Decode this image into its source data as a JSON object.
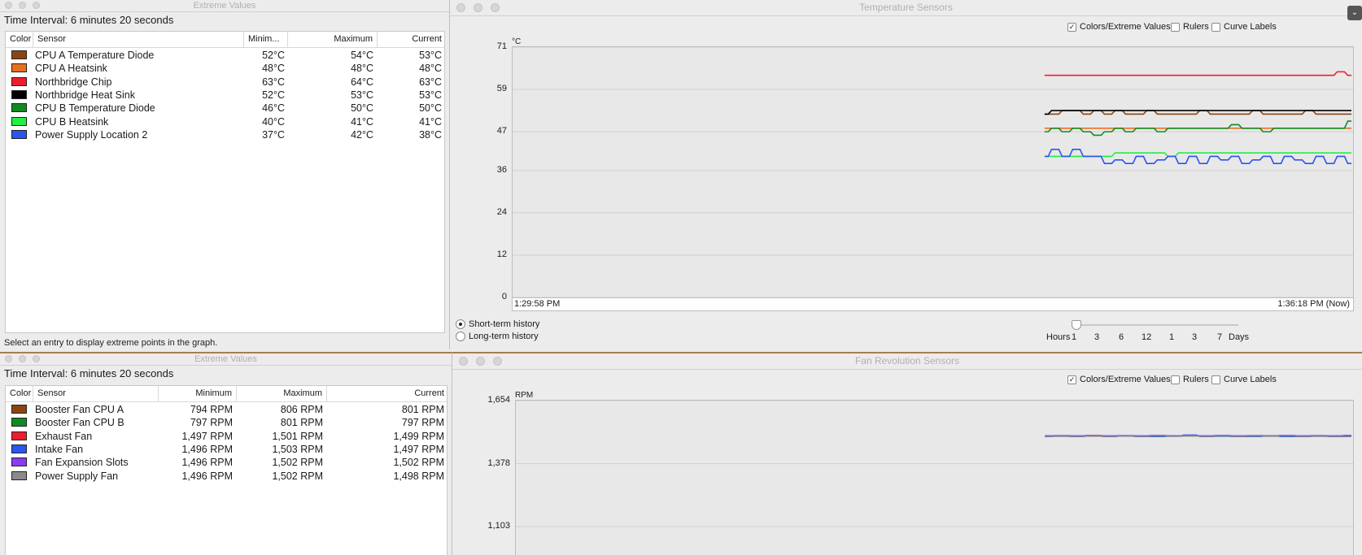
{
  "extreme_top": {
    "window_title": "Extreme Values",
    "interval": "Time Interval: 6 minutes 20 seconds",
    "headers": {
      "color": "Color",
      "sensor": "Sensor",
      "min": "Minim...",
      "max": "Maximum",
      "current": "Current"
    },
    "rows": [
      {
        "color": "#8b4513",
        "sensor": "CPU A Temperature Diode",
        "min": "52°C",
        "max": "54°C",
        "current": "53°C"
      },
      {
        "color": "#e87020",
        "sensor": "CPU A Heatsink",
        "min": "48°C",
        "max": "48°C",
        "current": "48°C"
      },
      {
        "color": "#ee1c2e",
        "sensor": "Northbridge Chip",
        "min": "63°C",
        "max": "64°C",
        "current": "63°C"
      },
      {
        "color": "#000000",
        "sensor": "Northbridge Heat Sink",
        "min": "52°C",
        "max": "53°C",
        "current": "53°C"
      },
      {
        "color": "#128a22",
        "sensor": "CPU B Temperature Diode",
        "min": "46°C",
        "max": "50°C",
        "current": "50°C"
      },
      {
        "color": "#22ee44",
        "sensor": "CPU B Heatsink",
        "min": "40°C",
        "max": "41°C",
        "current": "41°C"
      },
      {
        "color": "#2a55f0",
        "sensor": "Power Supply Location 2",
        "min": "37°C",
        "max": "42°C",
        "current": "38°C"
      }
    ],
    "status": "Select an entry to display extreme points in the graph."
  },
  "extreme_bottom": {
    "window_title": "Extreme Values",
    "interval": "Time Interval: 6 minutes 20 seconds",
    "headers": {
      "color": "Color",
      "sensor": "Sensor",
      "min": "Minimum",
      "max": "Maximum",
      "current": "Current"
    },
    "rows": [
      {
        "color": "#8b4513",
        "sensor": "Booster Fan CPU A",
        "min": "794 RPM",
        "max": "806 RPM",
        "current": "801 RPM"
      },
      {
        "color": "#128a22",
        "sensor": "Booster Fan CPU B",
        "min": "797 RPM",
        "max": "801 RPM",
        "current": "797 RPM"
      },
      {
        "color": "#ee1c2e",
        "sensor": "Exhaust Fan",
        "min": "1,497 RPM",
        "max": "1,501 RPM",
        "current": "1,499 RPM"
      },
      {
        "color": "#2a55f0",
        "sensor": "Intake Fan",
        "min": "1,496 RPM",
        "max": "1,503 RPM",
        "current": "1,497 RPM"
      },
      {
        "color": "#8a3cf0",
        "sensor": "Fan Expansion Slots",
        "min": "1,496 RPM",
        "max": "1,502 RPM",
        "current": "1,502 RPM"
      },
      {
        "color": "#8a8a8a",
        "sensor": "Power Supply Fan",
        "min": "1,496 RPM",
        "max": "1,502 RPM",
        "current": "1,498 RPM"
      }
    ]
  },
  "temp_window": {
    "window_title": "Temperature Sensors",
    "options": {
      "colors": "Colors/Extreme Values",
      "rulers": "Rulers",
      "curve_labels": "Curve Labels"
    },
    "radio_short": "Short-term history",
    "radio_long": "Long-term history",
    "slider": {
      "hours": "Hours",
      "days": "Days",
      "ticks": [
        "1",
        "3",
        "6",
        "12",
        "1",
        "3",
        "7"
      ]
    }
  },
  "fan_window": {
    "window_title": "Fan Revolution Sensors",
    "options": {
      "colors": "Colors/Extreme Values",
      "rulers": "Rulers",
      "curve_labels": "Curve Labels"
    }
  },
  "chart_data": [
    {
      "type": "line",
      "ylabel": "°C",
      "ylim": [
        0,
        71
      ],
      "yticks": [
        "71",
        "59",
        "47",
        "36",
        "24",
        "12",
        "0"
      ],
      "x_start_label": "1:29:58 PM",
      "x_end_label": "1:36:18 PM (Now)",
      "grid": true,
      "series": [
        {
          "name": "CPU A Temperature Diode",
          "color": "#8b4513",
          "values": [
            52,
            52,
            53,
            53,
            52,
            53,
            52,
            53,
            52,
            52,
            53,
            52,
            52,
            52,
            52,
            53,
            52,
            52,
            52,
            52,
            53,
            52,
            52,
            52,
            52,
            53,
            52,
            52,
            52,
            52
          ]
        },
        {
          "name": "CPU A Heatsink",
          "color": "#e87020",
          "values": [
            48,
            48,
            48,
            48,
            48,
            48,
            48,
            48,
            48,
            48,
            48,
            48,
            48,
            48,
            48,
            48,
            48,
            48,
            48,
            48,
            48,
            48,
            48,
            48,
            48,
            48,
            48,
            48,
            48,
            48
          ]
        },
        {
          "name": "Northbridge Chip",
          "color": "#ee1c2e",
          "values": [
            63,
            63,
            63,
            63,
            63,
            63,
            63,
            63,
            63,
            63,
            63,
            63,
            63,
            63,
            63,
            63,
            63,
            63,
            63,
            63,
            63,
            63,
            63,
            63,
            63,
            63,
            63,
            63,
            64,
            63
          ]
        },
        {
          "name": "Northbridge Heat Sink",
          "color": "#000000",
          "values": [
            52,
            53,
            53,
            53,
            53,
            53,
            53,
            53,
            53,
            53,
            53,
            53,
            53,
            53,
            53,
            53,
            53,
            53,
            53,
            53,
            53,
            53,
            53,
            53,
            53,
            53,
            53,
            53,
            53,
            53
          ]
        },
        {
          "name": "CPU B Temperature Diode",
          "color": "#128a22",
          "values": [
            47,
            48,
            47,
            48,
            47,
            46,
            47,
            48,
            47,
            48,
            48,
            47,
            48,
            48,
            48,
            48,
            48,
            48,
            49,
            48,
            48,
            47,
            48,
            48,
            48,
            48,
            48,
            48,
            48,
            50
          ]
        },
        {
          "name": "CPU B Heatsink",
          "color": "#22ee44",
          "values": [
            40,
            40,
            40,
            40,
            40,
            40,
            40,
            41,
            41,
            41,
            41,
            41,
            40,
            41,
            41,
            41,
            41,
            41,
            41,
            41,
            41,
            41,
            41,
            41,
            41,
            41,
            41,
            41,
            41,
            41
          ]
        },
        {
          "name": "Power Supply Location 2",
          "color": "#2a55f0",
          "values": [
            40,
            42,
            40,
            42,
            40,
            40,
            38,
            39,
            38,
            40,
            38,
            39,
            40,
            38,
            40,
            38,
            40,
            39,
            40,
            38,
            39,
            40,
            38,
            40,
            39,
            38,
            40,
            38,
            40,
            38
          ]
        }
      ]
    },
    {
      "type": "line",
      "ylabel": "RPM",
      "ylim": [
        1103,
        1654
      ],
      "yticks": [
        "1,654",
        "1,378",
        "1,103"
      ],
      "grid": true,
      "series": [
        {
          "name": "Exhaust Fan",
          "color": "#ee1c2e",
          "values": [
            1499,
            1499,
            1500,
            1499,
            1499,
            1500,
            1499,
            1499,
            1499,
            1501,
            1499,
            1499,
            1500,
            1499,
            1499,
            1499,
            1500,
            1499,
            1499,
            1499
          ]
        },
        {
          "name": "Intake Fan",
          "color": "#2a55f0",
          "values": [
            1497,
            1498,
            1497,
            1500,
            1497,
            1499,
            1497,
            1497,
            1498,
            1503,
            1497,
            1498,
            1497,
            1497,
            1499,
            1497,
            1497,
            1498,
            1497,
            1497
          ]
        },
        {
          "name": "Fan Expansion Slots",
          "color": "#8a3cf0",
          "values": [
            1500,
            1501,
            1500,
            1502,
            1500,
            1501,
            1500,
            1502,
            1500,
            1501,
            1500,
            1502,
            1500,
            1501,
            1500,
            1502,
            1500,
            1501,
            1500,
            1502
          ]
        },
        {
          "name": "Power Supply Fan",
          "color": "#8a8a8a",
          "values": [
            1498,
            1499,
            1498,
            1500,
            1498,
            1499,
            1498,
            1500,
            1498,
            1499,
            1498,
            1500,
            1498,
            1499,
            1498,
            1500,
            1498,
            1499,
            1498,
            1498
          ]
        }
      ]
    }
  ]
}
